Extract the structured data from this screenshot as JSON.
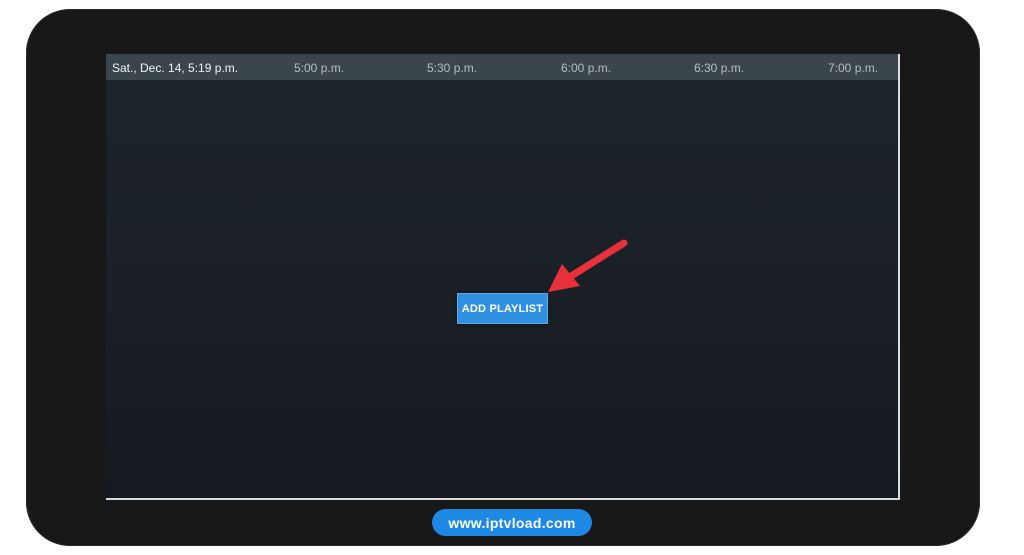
{
  "timeline": {
    "current_datetime": "Sat., Dec. 14, 5:19 p.m.",
    "slots": [
      "5:00 p.m.",
      "5:30 p.m.",
      "6:00 p.m.",
      "6:30 p.m.",
      "7:00 p.m."
    ]
  },
  "main": {
    "add_playlist_label": "ADD PLAYLIST"
  },
  "watermark": {
    "text": "www.iptvload.com"
  },
  "icons": {
    "pointer": "red-arrow-icon"
  },
  "colors": {
    "device_frame": "#181818",
    "timeline_bar": "#3a464c",
    "button_blue": "#2f8fe0",
    "arrow_red": "#e8313a",
    "watermark_blue": "#1e88e5"
  }
}
